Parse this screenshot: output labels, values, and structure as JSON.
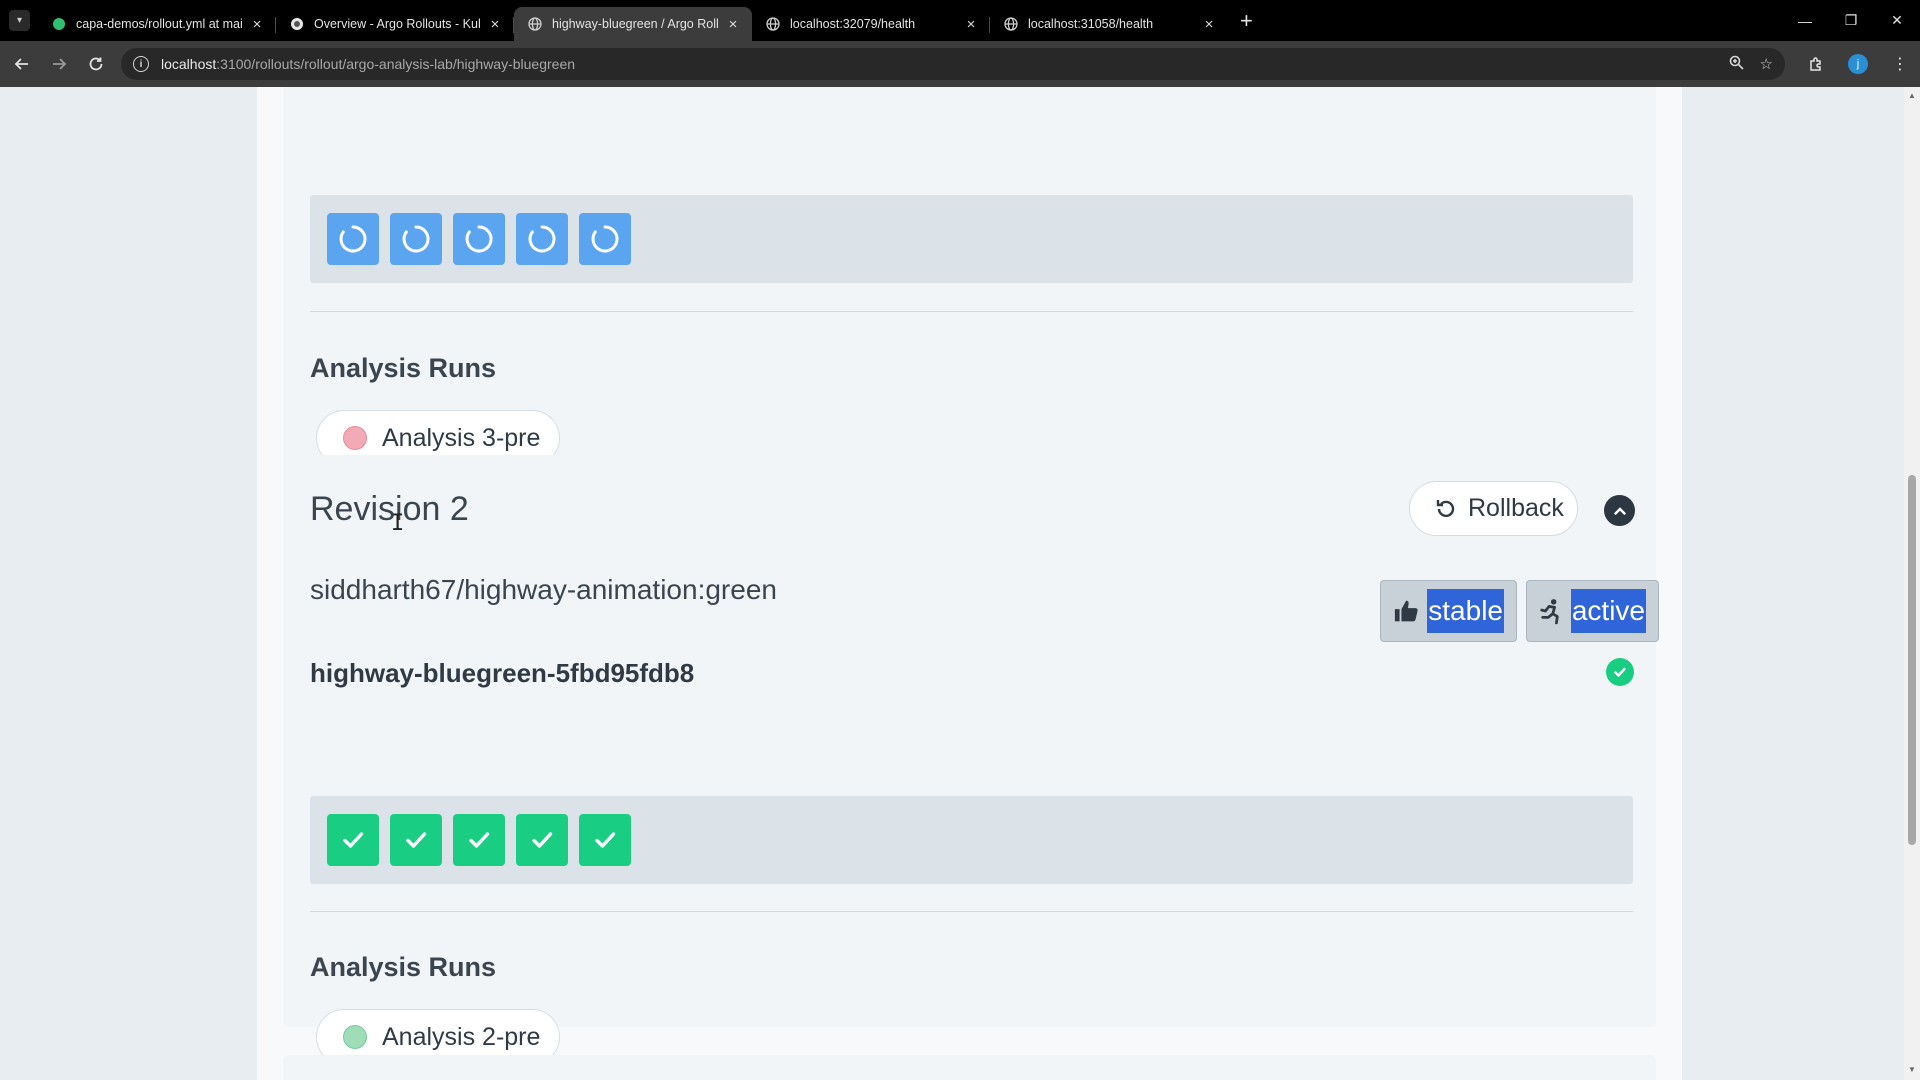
{
  "browser": {
    "tabs": [
      {
        "title": "capa-demos/rollout.yml at mai",
        "active": false
      },
      {
        "title": "Overview - Argo Rollouts - Kub",
        "active": false
      },
      {
        "title": "highway-bluegreen / Argo Roll",
        "active": true
      },
      {
        "title": "localhost:32079/health",
        "active": false
      },
      {
        "title": "localhost:31058/health",
        "active": false
      }
    ],
    "url_host": "localhost",
    "url_path": ":3100/rollouts/rollout/argo-analysis-lab/highway-bluegreen",
    "profile_initial": "j"
  },
  "top_section": {
    "pods": [
      "progressing",
      "progressing",
      "progressing",
      "progressing",
      "progressing"
    ],
    "analysis_title": "Analysis Runs",
    "analysis_run": {
      "label": "Analysis 3-pre",
      "status_color": "#f2aab6"
    }
  },
  "revision2": {
    "title": "Revision 2",
    "rollback_label": "Rollback",
    "image": "siddharth67/highway-animation:green",
    "badges": [
      {
        "label": "stable",
        "icon": "thumbs-up-icon"
      },
      {
        "label": "active",
        "icon": "running-icon"
      }
    ],
    "replicaset": "highway-bluegreen-5fbd95fdb8",
    "pods": [
      "healthy",
      "healthy",
      "healthy",
      "healthy",
      "healthy"
    ],
    "analysis_title": "Analysis Runs",
    "analysis_run": {
      "label": "Analysis 2-pre",
      "status_color": "#9fdcb8"
    }
  },
  "colors": {
    "progressing": "#5ba5f0",
    "healthy": "#19ce83",
    "highlight": "#2f65d8"
  }
}
